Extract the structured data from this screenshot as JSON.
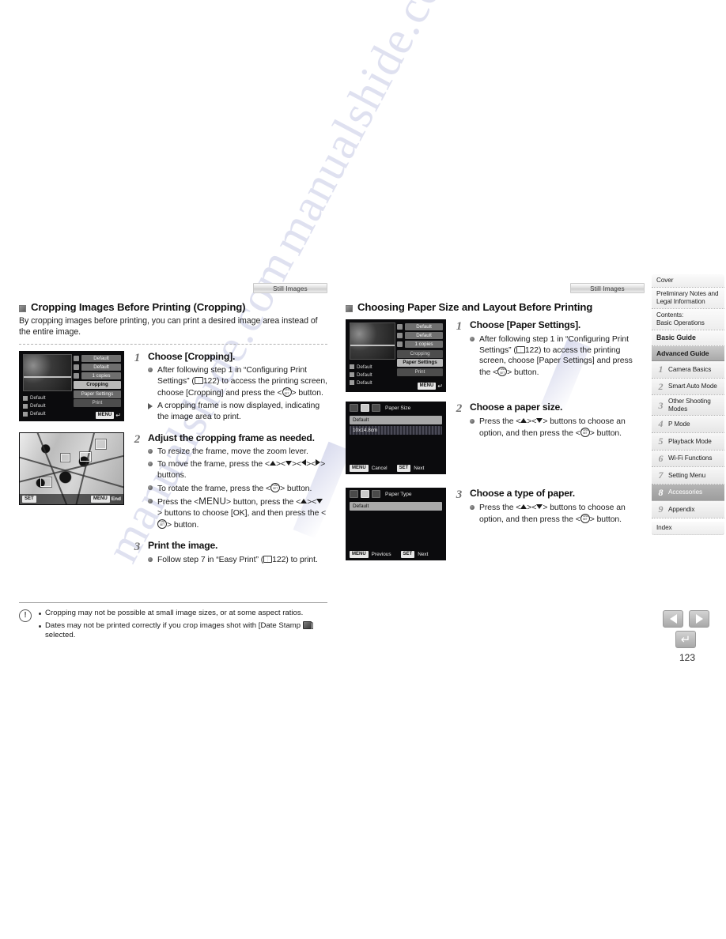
{
  "page": {
    "number": "123",
    "watermark": "manualshide.com"
  },
  "left_column": {
    "still_images_tag": "Still Images",
    "heading": "Cropping Images Before Printing (Cropping)",
    "description": "By cropping images before printing, you can print a desired image area instead of the entire image.",
    "steps": [
      {
        "num": "1",
        "title": "Choose [Cropping].",
        "bullets": [
          {
            "type": "dot",
            "text_a": "After following step 1 in “Configuring Print Settings” (",
            "page_ref": "122",
            "text_b": ") to access the printing screen, choose [Cropping] and press the <",
            "text_c": "> button."
          },
          {
            "type": "triangle",
            "text": "A cropping frame is now displayed, indicating the image area to print."
          }
        ]
      },
      {
        "num": "2",
        "title": "Adjust the cropping frame as needed.",
        "bullets": [
          {
            "type": "dot",
            "text": "To resize the frame, move the zoom lever."
          },
          {
            "type": "dot",
            "text_a": "To move the frame, press the <",
            "text_b": "> buttons."
          },
          {
            "type": "dot",
            "text_a": "To rotate the frame, press the <",
            "text_b": "> button."
          },
          {
            "type": "dot",
            "text_a": "Press the <",
            "menu": "MENU",
            "text_b": "> button, press the <",
            "text_c": "> buttons to choose [OK], and then press the <",
            "text_d": "> button."
          }
        ]
      },
      {
        "num": "3",
        "title": "Print the image.",
        "bullets": [
          {
            "type": "dot",
            "text_a": "Follow step 7 in “Easy Print” (",
            "page_ref": "122",
            "text_b": ") to print."
          }
        ]
      }
    ],
    "notes": [
      "Cropping may not be possible at small image sizes, or at some aspect ratios.",
      "Dates may not be printed correctly if you crop images shot with [Date Stamp  ] selected."
    ],
    "note_line2_a": "Dates may not be printed correctly if you crop images shot with [Date Stamp ",
    "note_line2_b": "] selected."
  },
  "right_column": {
    "still_images_tag": "Still Images",
    "heading": "Choosing Paper Size and Layout Before Printing",
    "steps": [
      {
        "num": "1",
        "title": "Choose [Paper Settings].",
        "bullets": [
          {
            "type": "dot",
            "text_a": "After following step 1 in “Configuring Print Settings” (",
            "page_ref": "122",
            "text_b": ") to access the printing screen, choose [Paper Settings] and press the <",
            "text_c": "> button."
          }
        ]
      },
      {
        "num": "2",
        "title": "Choose a paper size.",
        "bullets": [
          {
            "type": "dot",
            "text_a": "Press the <",
            "text_b": "><",
            "text_c": "> buttons to choose an option, and then press the <",
            "text_d": "> button."
          }
        ]
      },
      {
        "num": "3",
        "title": "Choose a type of paper.",
        "bullets": [
          {
            "type": "dot",
            "text_a": "Press the <",
            "text_b": "><",
            "text_c": "> buttons to choose an option, and then press the <",
            "text_d": "> button."
          }
        ]
      }
    ]
  },
  "camera_screens": {
    "print_settings": {
      "left_options": [
        "Default",
        "Default",
        "Default"
      ],
      "right_values": [
        "Default",
        "Default",
        "1 copies"
      ],
      "menu_items": [
        {
          "label": "Cropping",
          "selected": false
        },
        {
          "label": "Paper Settings",
          "selected": false
        },
        {
          "label": "Print",
          "selected": false
        }
      ],
      "footer_badge": "MENU"
    },
    "print_settings_2": {
      "left_options": [
        "Default",
        "Default",
        "Default"
      ],
      "right_values": [
        "Default",
        "Default",
        "1 copies"
      ],
      "menu_items": [
        {
          "label": "Cropping",
          "selected": false
        },
        {
          "label": "Paper Settings",
          "selected": true
        },
        {
          "label": "Print",
          "selected": false
        }
      ],
      "footer_badge": "MENU"
    },
    "cropping_frame": {
      "left_badge": "SET",
      "right_badge": "MENU",
      "right_label": "End"
    },
    "paper_size": {
      "title": "Paper Size",
      "options": [
        "Default",
        "10x14.8cm"
      ],
      "selected_index": 0,
      "footer_left_badge": "MENU",
      "footer_left_label": "Cancel",
      "footer_right_badge": "SET",
      "footer_right_label": "Next",
      "active_tile_index": 1
    },
    "paper_type": {
      "title": "Paper Type",
      "options": [
        "Default"
      ],
      "selected_index": 0,
      "footer_left_badge": "MENU",
      "footer_left_label": "Previous",
      "footer_right_badge": "SET",
      "footer_right_label": "Next",
      "active_tile_index": 1
    }
  },
  "sidebar": {
    "items": [
      {
        "label": "Cover",
        "kind": "plain"
      },
      {
        "label": "Preliminary Notes and Legal Information",
        "kind": "plain"
      },
      {
        "label": "Contents:\nBasic Operations",
        "kind": "plain"
      },
      {
        "label": "Basic Guide",
        "kind": "big"
      },
      {
        "label": "Advanced Guide",
        "kind": "section"
      }
    ],
    "chapters": [
      {
        "num": "1",
        "label": "Camera Basics",
        "active": false
      },
      {
        "num": "2",
        "label": "Smart Auto Mode",
        "active": false
      },
      {
        "num": "3",
        "label": "Other Shooting Modes",
        "active": false
      },
      {
        "num": "4",
        "label": "P Mode",
        "active": false
      },
      {
        "num": "5",
        "label": "Playback Mode",
        "active": false
      },
      {
        "num": "6",
        "label": "Wi-Fi Functions",
        "active": false
      },
      {
        "num": "7",
        "label": "Setting Menu",
        "active": false
      },
      {
        "num": "8",
        "label": "Accessories",
        "active": true
      },
      {
        "num": "9",
        "label": "Appendix",
        "active": false
      }
    ],
    "index_label": "Index"
  },
  "bottom_nav": {
    "prev_icon": "triangle-left-icon",
    "next_icon": "triangle-right-icon",
    "return_icon": "return-arrow-icon"
  },
  "colors": {
    "page_bg": "#ffffff",
    "text": "#1a1a1a",
    "sidebar_active": "#9d9d9d",
    "watermark": "#b9bde0"
  }
}
